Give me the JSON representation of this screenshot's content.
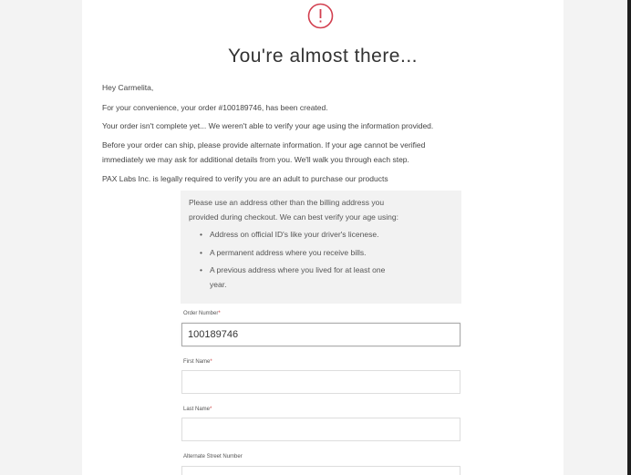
{
  "header": {
    "title": "You're almost there...",
    "icon": "exclamation-circle-icon",
    "accent_color": "#d23f4f"
  },
  "message": {
    "greeting": "Hey Carmelita,",
    "line1": "For your convenience, your order #100189746, has been created.",
    "line2": "Your order isn't complete yet... We weren't able to verify your age using the information provided.",
    "line3a": "Before your order can ship, please provide alternate information. If your age cannot be verified",
    "line3b": "immediately we may ask for additional details from you. We'll walk you through each step.",
    "line4": "PAX Labs Inc. is legally required to verify you are an adult to purchase our products"
  },
  "info_box": {
    "line1": "Please use an address other than the billing address you",
    "line2": "provided during checkout. We can best verify your age using:",
    "bullets": [
      "Address on official ID's like your driver's licenese.",
      "A permanent address where you receive bills.",
      "A previous address where you lived for at least one",
      "year."
    ]
  },
  "form": {
    "order_number": {
      "label": "Order Number",
      "value": "100189746"
    },
    "first_name": {
      "label": "First Name",
      "value": ""
    },
    "last_name": {
      "label": "Last Name",
      "value": ""
    },
    "street_number": {
      "label": "Alternate Street Number",
      "value": ""
    },
    "required_marker": "*"
  }
}
